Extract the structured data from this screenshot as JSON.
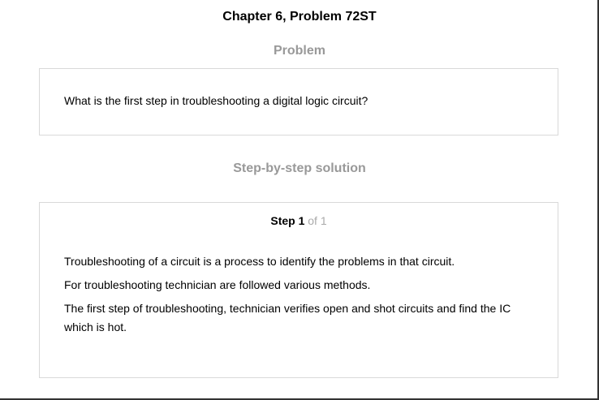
{
  "header": {
    "chapter_title": "Chapter 6, Problem 72ST"
  },
  "problem": {
    "heading": "Problem",
    "text": "What is the first step in troubleshooting a digital logic circuit?"
  },
  "solution": {
    "heading": "Step-by-step solution",
    "step": {
      "label": "Step 1",
      "of_text": " of 1"
    },
    "paragraphs": [
      "Troubleshooting of a circuit is a process to identify the problems in that circuit.",
      "For troubleshooting technician are followed various methods.",
      "The first step of troubleshooting, technician verifies open and shot circuits and find the IC which is hot."
    ]
  }
}
